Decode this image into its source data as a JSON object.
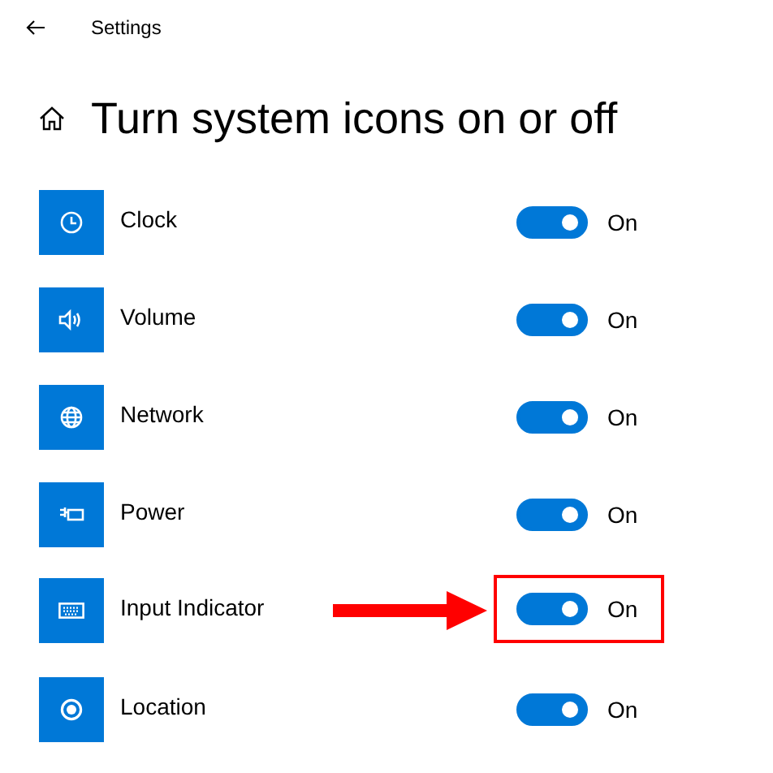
{
  "header": {
    "title": "Settings"
  },
  "page": {
    "title": "Turn system icons on or off"
  },
  "items": [
    {
      "kind": "clock",
      "label": "Clock",
      "on": true,
      "state_text": "On",
      "highlighted": false
    },
    {
      "kind": "volume",
      "label": "Volume",
      "on": true,
      "state_text": "On",
      "highlighted": false
    },
    {
      "kind": "network",
      "label": "Network",
      "on": true,
      "state_text": "On",
      "highlighted": false
    },
    {
      "kind": "power",
      "label": "Power",
      "on": true,
      "state_text": "On",
      "highlighted": false
    },
    {
      "kind": "keyboard",
      "label": "Input Indicator",
      "on": true,
      "state_text": "On",
      "highlighted": true
    },
    {
      "kind": "location",
      "label": "Location",
      "on": true,
      "state_text": "On",
      "highlighted": false
    }
  ]
}
